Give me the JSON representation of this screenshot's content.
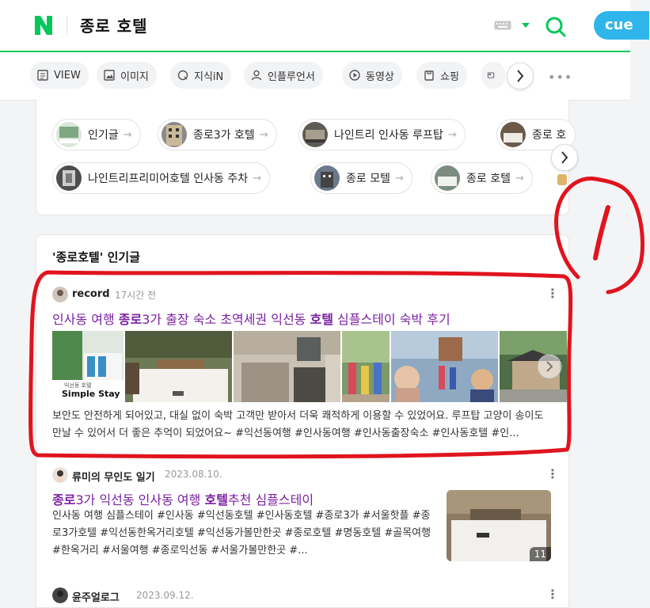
{
  "header": {
    "search_query": "종로 호텔",
    "cue_label": "cue",
    "accent": "#03c75a"
  },
  "tabs": [
    {
      "label": "VIEW",
      "icon": "document-icon"
    },
    {
      "label": "이미지",
      "icon": "image-icon"
    },
    {
      "label": "지식iN",
      "icon": "q-icon"
    },
    {
      "label": "인플루언서",
      "icon": "person-icon"
    },
    {
      "label": "동영상",
      "icon": "play-icon"
    },
    {
      "label": "쇼핑",
      "icon": "bag-icon"
    }
  ],
  "related": [
    {
      "label": "인기글"
    },
    {
      "label": "종로3가 호텔"
    },
    {
      "label": "나인트리 인사동 루프탑"
    },
    {
      "label": "종로 호"
    },
    {
      "label": "나인트리프리미어호텔 인사동 주차"
    },
    {
      "label": "종로 모텔"
    },
    {
      "label": "종로 호텔"
    }
  ],
  "popular": {
    "title": "'종로호텔' 인기글",
    "posts": [
      {
        "author": "record",
        "time": "17시간 전",
        "title_parts": [
          "인사동 여행 ",
          "종로",
          "3가 출장 숙소 초역세권 익선동 ",
          "호텔",
          " 심플스테이 숙박 후기"
        ],
        "image_caption_small": "익선동 호텔",
        "image_caption": "Simple Stay",
        "snippet": "보안도 안전하게 되어있고, 대실 없이 숙박 고객만 받아서 더욱 쾌적하게 이용할 수 있었어요. 루프탑 고양이 송이도 만날 수 있어서 더 좋은 추억이 되었어요~ #익선동여행 #인사동여행 #인사동출장숙소 #인사동호텔 #인..."
      },
      {
        "author": "류미의 무인도 일기",
        "time": "2023.08.10.",
        "title_parts": [
          "종로",
          "3가 익선동 인사동 여행 ",
          "호텔",
          "추천 심플스테이"
        ],
        "snippet": "인사동 여행 심플스테이 #인사동 #익선동호텔 #인사동호텔 #종로3가 #서울핫플 #종로3가호텔 #익선동한옥거리호텔 #익선동가볼만한곳 #종로호텔 #명동호텔 #골목여행 #한옥거리 #서울여행 #종로익선동 #서울가볼만한곳 #...",
        "image_count": "11"
      },
      {
        "author": "윤주얼로그",
        "time": "2023.09.12."
      }
    ]
  },
  "annotation": {
    "text": "1",
    "color": "#e0141e"
  }
}
